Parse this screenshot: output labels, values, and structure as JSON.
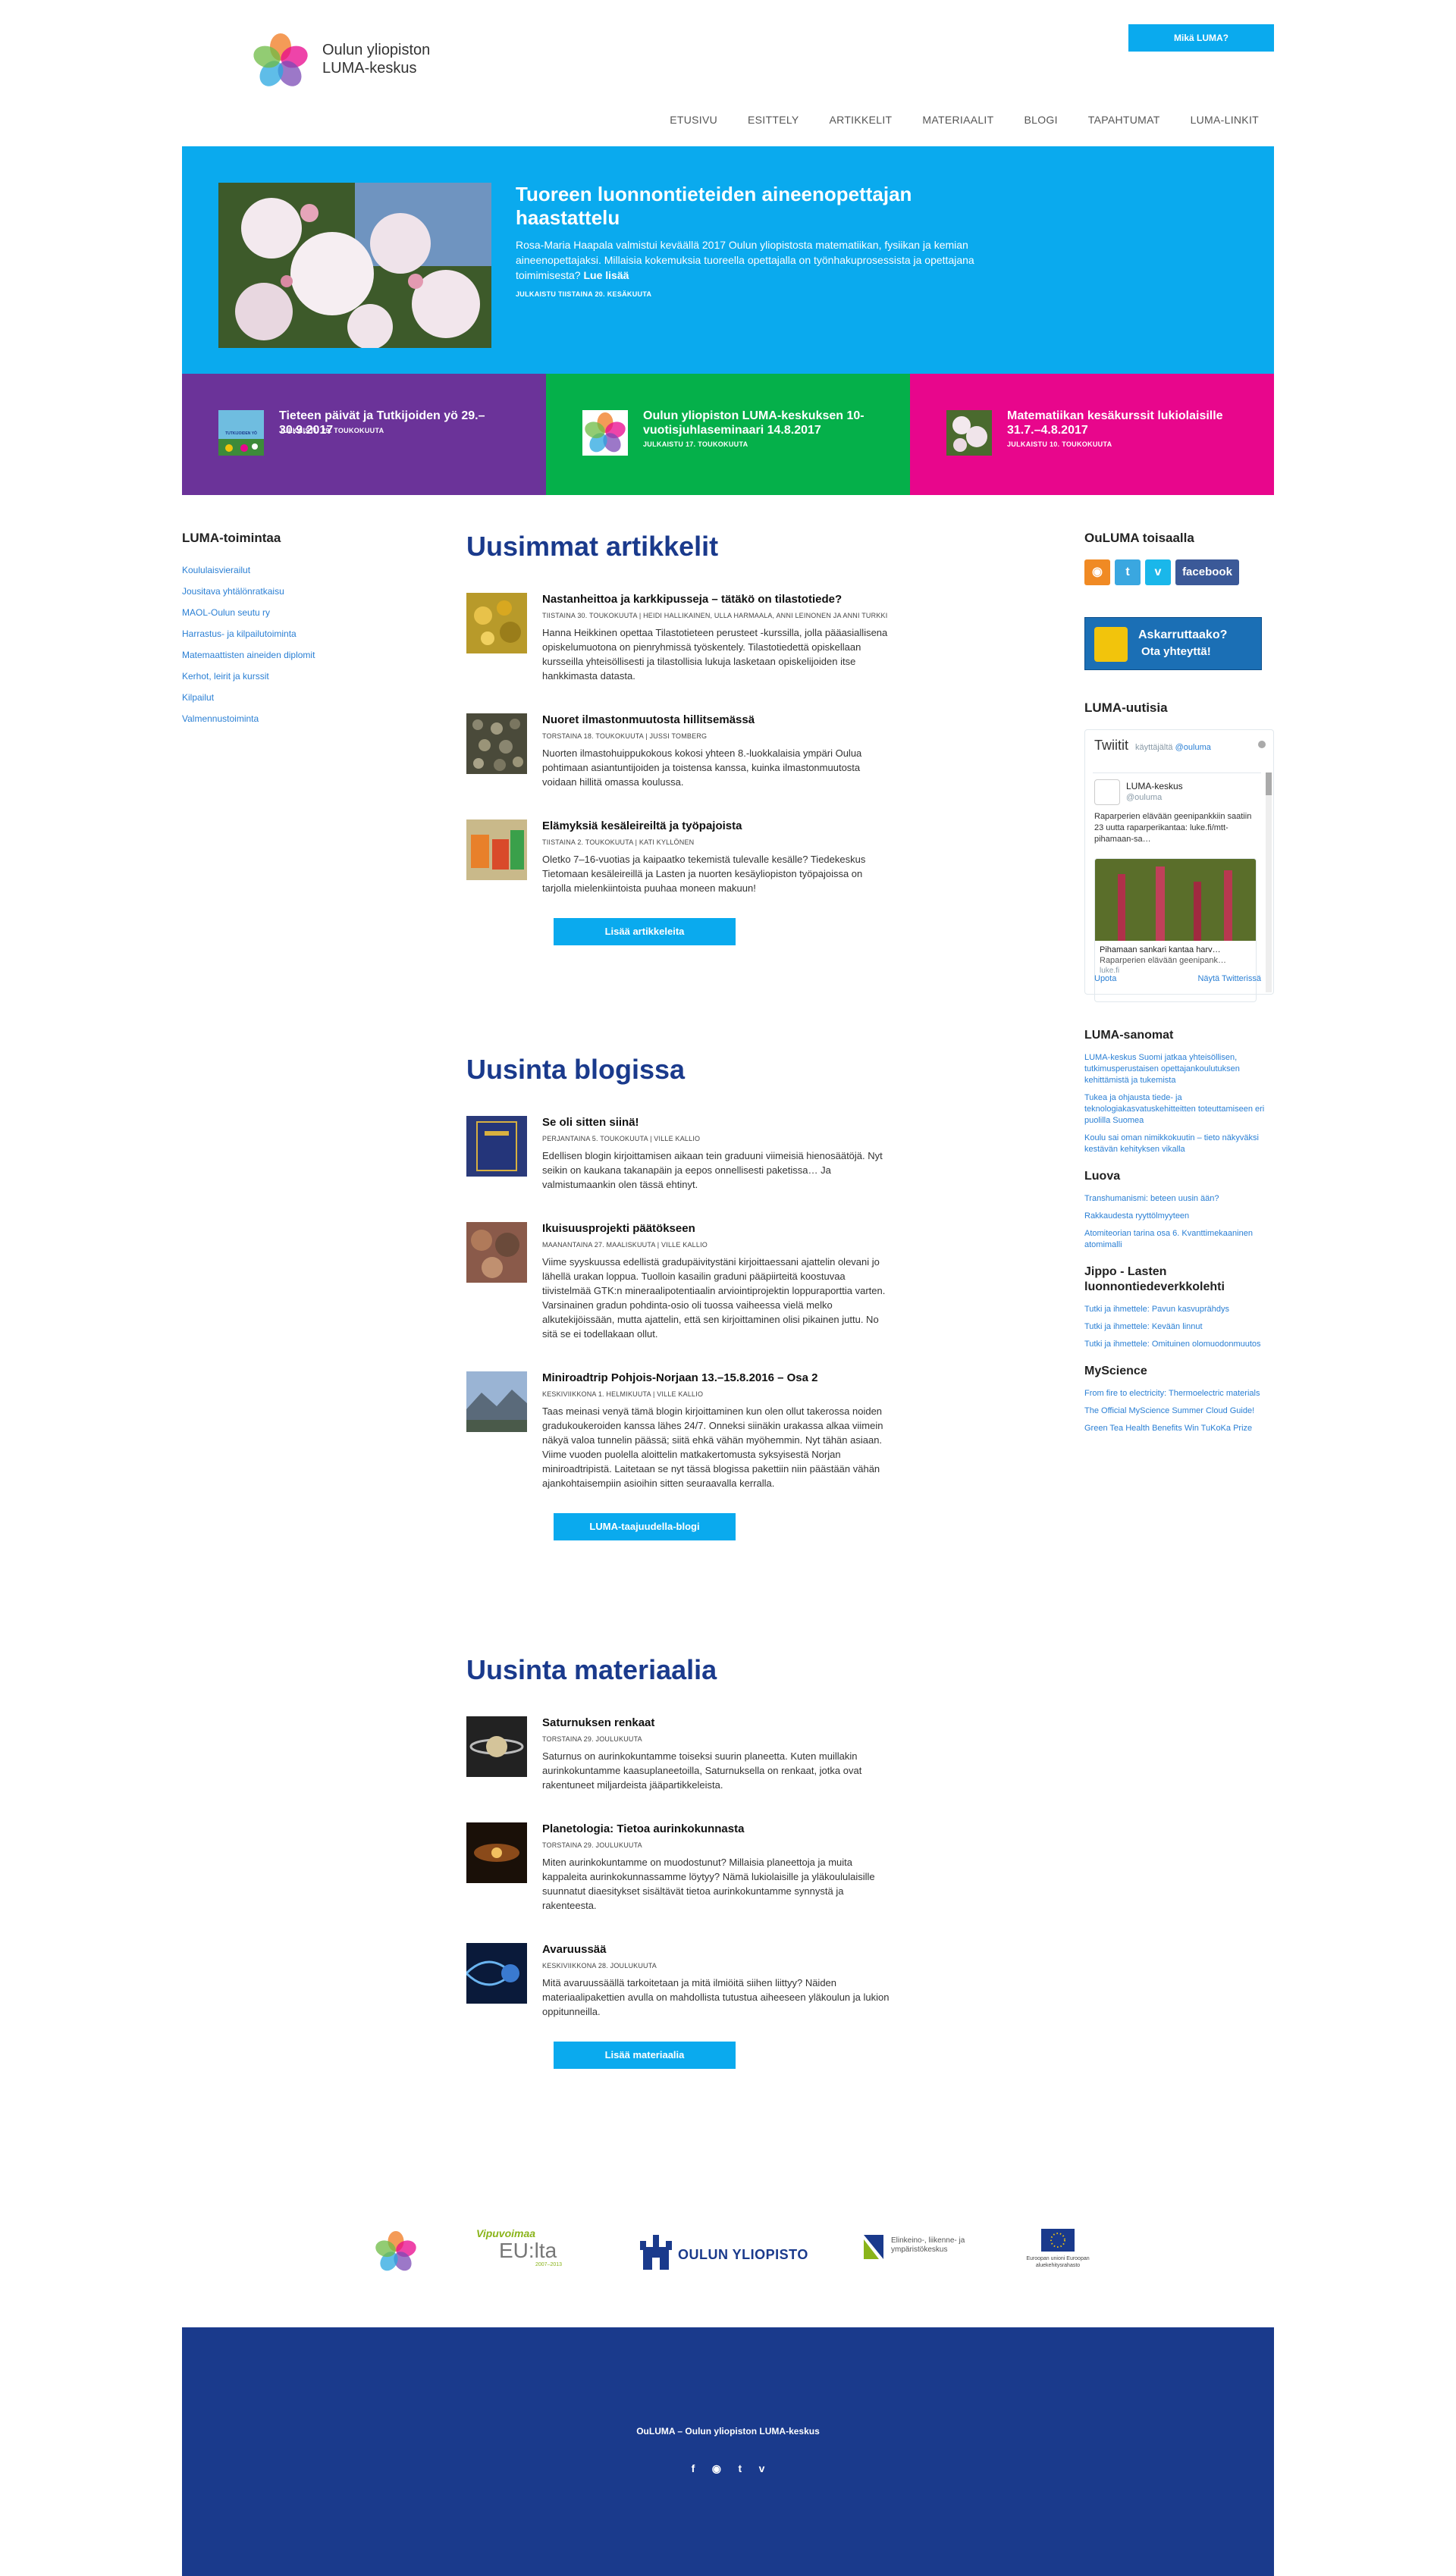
{
  "header": {
    "logo_line1": "Oulun yliopiston",
    "logo_line2": "LUMA-keskus",
    "cta": "Mikä LUMA?",
    "nav": [
      "ETUSIVU",
      "ESITTELY",
      "ARTIKKELIT",
      "MATERIAALIT",
      "BLOGI",
      "TAPAHTUMAT",
      "LUMA-LINKIT"
    ]
  },
  "hero": {
    "title": "Tuoreen luonnontieteiden aineenopettajan haastattelu",
    "text": "Rosa-Maria Haapala valmistui keväällä 2017 Oulun yliopistosta matematiikan, fysiikan ja kemian aineenopettajaksi. Millaisia kokemuksia tuoreella opettajalla on työnhakuprosessista ja opettajana toimimisesta?",
    "read_more": "Lue lisää",
    "date": "JULKAISTU TIISTAINA 20. KESÄKUUTA",
    "color": "#0aaaee"
  },
  "tiles": [
    {
      "title": "Tieteen päivät ja Tutkijoiden yö 29.–30.9.2017",
      "date": "JULKAISTU 29. TOUKOKUUTA",
      "color": "#6b3399",
      "thumb_text": "TUTKIJOIDEN YÖ"
    },
    {
      "title": "Oulun yliopiston LUMA-keskuksen 10-vuotisjuhlaseminaari 14.8.2017",
      "date": "JULKAISTU 17. TOUKOKUUTA",
      "color": "#05b04a"
    },
    {
      "title": "Matematiikan kesäkurssit lukiolaisille 31.7.–4.8.2017",
      "date": "JULKAISTU 10. TOUKOKUUTA",
      "color": "#e8068c"
    }
  ],
  "left": {
    "heading": "LUMA-toimintaa",
    "links": [
      "Koululaisvierailut",
      "Jousitava yhtälönratkaisu",
      "MAOL-Oulun seutu ry",
      "Harrastus- ja kilpailutoiminta",
      "Matemaattisten aineiden diplomit",
      "Kerhot, leirit ja kurssit",
      "Kilpailut",
      "Valmennustoiminta"
    ]
  },
  "articles": {
    "heading": "Uusimmat artikkelit",
    "items": [
      {
        "title": "Nastanheittoa ja karkkipusseja – tätäkö on tilastotiede?",
        "meta": "TIISTAINA 30. TOUKOKUUTA | HEIDI HALLIKAINEN, ULLA HARMAALA, ANNI LEINONEN JA ANNI TURKKI",
        "excerpt": "Hanna Heikkinen opettaa Tilastotieteen perusteet -kurssilla, jolla pääasiallisena opiskelumuotona on pienryhmissä työskentely. Tilastotiedettä opiskellaan kursseilla yhteisöllisesti ja tilastollisia lukuja lasketaan opiskelijoiden itse hankkimasta datasta."
      },
      {
        "title": "Nuoret ilmastonmuutosta hillitsemässä",
        "meta": "TORSTAINA 18. TOUKOKUUTA | JUSSI TOMBERG",
        "excerpt": "Nuorten ilmastohuippukokous kokosi yhteen 8.-luokkalaisia ympäri Oulua pohtimaan asiantuntijoiden ja toistensa kanssa, kuinka ilmastonmuutosta voidaan hillitä omassa koulussa."
      },
      {
        "title": "Elämyksiä kesäleireiltä ja työpajoista",
        "meta": "TIISTAINA 2. TOUKOKUUTA | KATI KYLLÖNEN",
        "excerpt": "Oletko 7–16-vuotias ja kaipaatko tekemistä tulevalle kesälle? Tiedekeskus Tietomaan kesäleireillä ja Lasten ja nuorten kesäyliopiston työpajoissa on tarjolla mielenkiintoista puuhaa moneen makuun!"
      }
    ],
    "button": "Lisää artikkeleita"
  },
  "blog": {
    "heading": "Uusinta blogissa",
    "items": [
      {
        "title": "Se oli sitten siinä!",
        "meta": "PERJANTAINA 5. TOUKOKUUTA | VILLE KALLIO",
        "excerpt": "Edellisen blogin kirjoittamisen aikaan tein graduuni viimeisiä hienosäätöjä. Nyt seikin on kaukana takanapäin ja eepos onnellisesti paketissa… Ja valmistumaankin olen tässä ehtinyt."
      },
      {
        "title": "Ikuisuusprojekti päätökseen",
        "meta": "MAANANTAINA 27. MAALISKUUTA | VILLE KALLIO",
        "excerpt": "Viime syyskuussa edellistä gradupäivitystäni kirjoittaessani ajattelin olevani jo lähellä urakan loppua. Tuolloin kasailin graduni pääpiirteitä koostuvaa tiivistelmää GTK:n mineraalipotentiaalin arviointiprojektin loppuraporttia varten. Varsinainen gradun pohdinta-osio oli tuossa vaiheessa vielä melko alkutekijöissään, mutta ajattelin, että sen kirjoittaminen olisi pikainen juttu. No sitä se ei todellakaan ollut."
      },
      {
        "title": "Miniroadtrip Pohjois-Norjaan 13.–15.8.2016 – Osa 2",
        "meta": "KESKIVIIKKONA 1. HELMIKUUTA | VILLE KALLIO",
        "excerpt": "Taas meinasi venyä tämä blogin kirjoittaminen kun olen ollut takerossa noiden gradukoukeroiden kanssa lähes 24/7. Onneksi siinäkin urakassa alkaa viimein näkyä valoa tunnelin päässä; siitä ehkä vähän myöhemmin. Nyt tähän asiaan. Viime vuoden puolella aloittelin matkakertomusta syksyisestä Norjan miniroadtripistä. Laitetaan se nyt tässä blogissa pakettiin niin päästään vähän ajankohtaisempiin asioihin sitten seuraavalla kerralla."
      }
    ],
    "button": "LUMA-taajuudella-blogi"
  },
  "material": {
    "heading": "Uusinta materiaalia",
    "items": [
      {
        "title": "Saturnuksen renkaat",
        "meta": "TORSTAINA 29. JOULUKUUTA",
        "excerpt": "Saturnus on aurinkokuntamme toiseksi suurin planeetta. Kuten muillakin aurinkokuntamme kaasuplaneetoilla, Saturnuksella on renkaat, jotka ovat rakentuneet miljardeista jääpartikkeleista."
      },
      {
        "title": "Planetologia: Tietoa aurinkokunnasta",
        "meta": "TORSTAINA 29. JOULUKUUTA",
        "excerpt": "Miten aurinkokuntamme on muodostunut? Millaisia planeettoja ja muita kappaleita aurinkokunnassamme löytyy? Nämä lukiolaisille ja yläkoululaisille suunnatut diaesitykset sisältävät tietoa aurinkokuntamme synnystä ja rakenteesta."
      },
      {
        "title": "Avaruussää",
        "meta": "KESKIVIIKKONA 28. JOULUKUUTA",
        "excerpt": "Mitä avaruussäällä tarkoitetaan ja mitä ilmiöitä siihen liittyy? Näiden materiaalipakettien avulla on mahdollista tutustua aiheeseen yläkoulun ja lukion oppitunneilla."
      }
    ],
    "button": "Lisää materiaalia"
  },
  "right": {
    "social_heading": "OuLUMA toisaalla",
    "social": [
      "rss-icon",
      "twitter-icon",
      "vimeo-icon",
      "facebook"
    ],
    "facebook_label": "facebook",
    "ask_line1": "Askarruttaako?",
    "ask_line2": "Ota yhteyttä!",
    "news_heading": "LUMA-uutisia",
    "twitter": {
      "title": "Twiitit",
      "by": "käyttäjältä",
      "handle_link": "@ouluma",
      "name": "LUMA-keskus",
      "handle": "@ouluma",
      "text": "Raparperien elävään geenipankkiin saatiin 23 uutta raparperikantaa: luke.fi/mtt-pihamaan-sa…",
      "card_title": "Pihamaan sankari kantaa harv…",
      "card_desc": "Raparperien elävään geenipank…",
      "card_url": "luke.fi",
      "embed": "Upota",
      "view": "Näytä Twitterissä"
    },
    "sanomat": {
      "heading": "LUMA-sanomat",
      "links": [
        "LUMA-keskus Suomi jatkaa yhteisöllisen, tutkimusperustaisen opettajankoulutuksen kehittämistä ja tukemista",
        "Tukea ja ohjausta tiede- ja teknologiakasvatuskehitteitten toteuttamiseen eri puolilla Suomea",
        "Koulu sai oman nimikkokuutin – tieto näkyväksi kestävän kehityksen vikalla"
      ]
    },
    "luova": {
      "heading": "Luova",
      "links": [
        "Transhumanismi: beteen uusin ään?",
        "Rakkaudesta ryyttölmyyteen",
        "Atomiteorian tarina osa 6. Kvanttimekaaninen atomimalli"
      ]
    },
    "jippo": {
      "heading": "Jippo - Lasten luonnontiedeverkkolehti",
      "links": [
        "Tutki ja ihmettele: Pavun kasvuprähdys",
        "Tutki ja ihmettele: Kevään linnut",
        "Tutki ja ihmettele: Omituinen olomuodonmuutos"
      ]
    },
    "myscience": {
      "heading": "MyScience",
      "links": [
        "From fire to electricity: Thermoelectric materials",
        "The Official MyScience Summer Cloud Guide!",
        "Green Tea Health Benefits Win TuKoKa Prize"
      ]
    }
  },
  "partners": {
    "vipuvoimaa": "Vipuvoimaa",
    "euta": "EU:lta",
    "euta_years": "2007–2013",
    "oulu": "OULUN YLIOPISTO",
    "ely": "Elinkeino-, liikenne- ja ympäristökeskus",
    "eu_text": "Euroopan unioni Euroopan aluekehitysrahasto"
  },
  "footer": {
    "title": "OuLUMA – Oulun yliopiston LUMA-keskus",
    "icons": [
      "facebook-icon",
      "rss-icon",
      "twitter-icon",
      "vimeo-icon"
    ],
    "color": "#1a3a8c"
  }
}
